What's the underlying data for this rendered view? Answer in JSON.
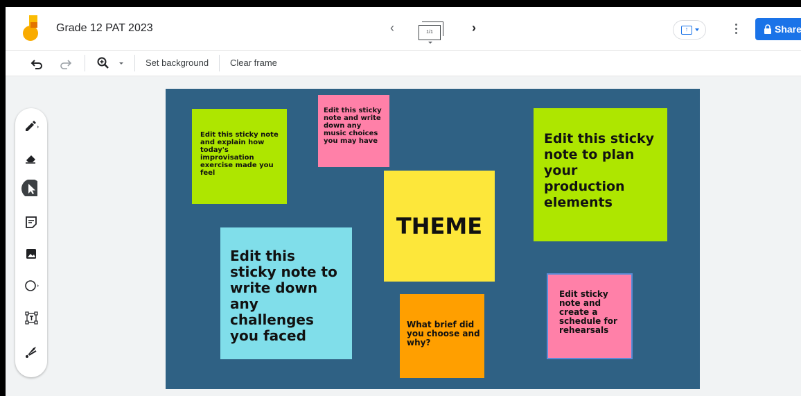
{
  "header": {
    "title": "Grade 12 PAT 2023",
    "frame_counter": "1/1",
    "share_label": "Share"
  },
  "toolbar": {
    "set_background": "Set background",
    "clear_frame": "Clear frame"
  },
  "icons": {
    "logo": "jamboard-logo-icon",
    "prev": "chevron-left-icon",
    "next": "chevron-right-icon",
    "present": "present-screen-icon",
    "more": "more-vert-icon",
    "lock": "lock-icon",
    "undo": "undo-icon",
    "redo": "redo-icon",
    "zoom": "zoom-icon",
    "pen": "pen-icon",
    "eraser": "eraser-icon",
    "select": "select-cursor-icon",
    "sticky": "sticky-note-icon",
    "image": "image-icon",
    "circle": "circle-shape-icon",
    "textbox": "text-box-icon",
    "laser": "laser-icon"
  },
  "canvas": {
    "background": "#2f6184",
    "notes": [
      {
        "text": "Edit this sticky note and explain how today's improvisation exercise made you feel",
        "color": "#aee600"
      },
      {
        "text": "Edit this sticky note and write down any music choices you may have",
        "color": "#ff80a8"
      },
      {
        "text": "THEME",
        "color": "#fde73a"
      },
      {
        "text": "Edit this sticky note to plan your production elements",
        "color": "#aee600"
      },
      {
        "text": "Edit this sticky note to write down any challenges you faced",
        "color": "#80deea"
      },
      {
        "text": "What brief did you choose and why?",
        "color": "#ff9f00"
      },
      {
        "text": "Edit sticky note and create a schedule for rehearsals",
        "color": "#ff80a8"
      }
    ]
  },
  "colors": {
    "accent": "#1a73e8"
  }
}
